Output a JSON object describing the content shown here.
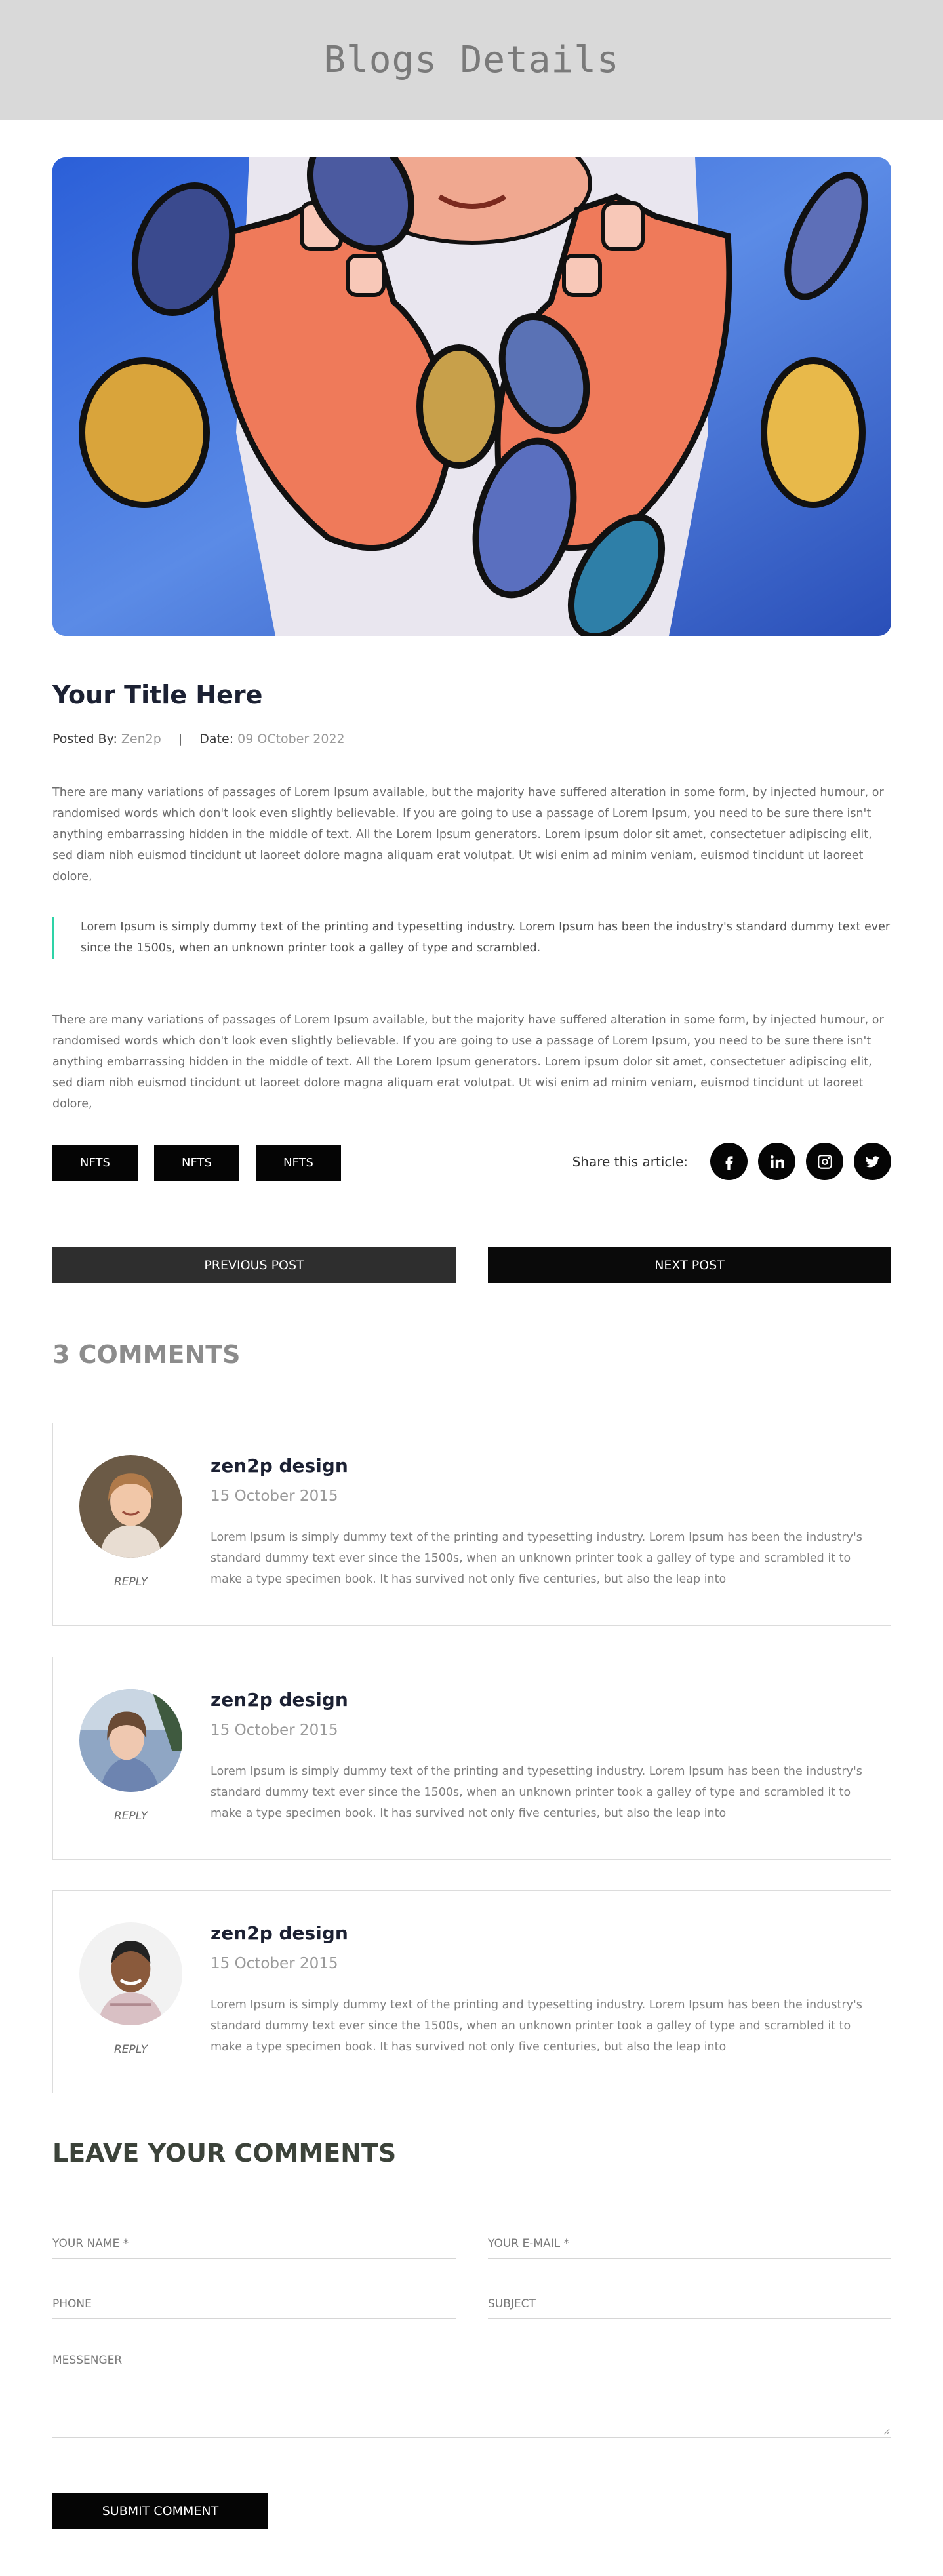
{
  "banner": {
    "title": "Blogs Details"
  },
  "hero": {
    "image": "illustration-hands-holding-nft-coins"
  },
  "post": {
    "title": "Your Title Here",
    "posted_by_label": "Posted By:",
    "author": "Zen2p",
    "separator": "|",
    "date_label": "Date:",
    "date": "09 OCtober 2022",
    "paragraph_1": "There are many variations of passages of Lorem Ipsum available, but the majority have suffered alteration in some form, by injected humour, or randomised words which don't look even slightly believable. If you are going to use a passage of Lorem Ipsum, you need to be sure there isn't anything embarrassing hidden in the middle of text. All the Lorem Ipsum generators. Lorem ipsum dolor sit amet, consectetuer adipiscing elit, sed diam nibh euismod tincidunt ut laoreet dolore magna aliquam erat volutpat. Ut wisi enim ad minim veniam, euismod tincidunt ut laoreet dolore,",
    "quote": "Lorem Ipsum is simply dummy text of the printing and typesetting industry. Lorem Ipsum has been the industry's standard dummy text ever since the 1500s, when an unknown printer took a galley of type and scrambled.",
    "paragraph_2": "There are many variations of passages of Lorem Ipsum available, but the majority have suffered alteration in some form, by injected humour, or randomised words which don't look even slightly believable. If you are going to use a passage of Lorem Ipsum, you need to be sure there isn't anything embarrassing hidden in the middle of text. All the Lorem Ipsum generators. Lorem ipsum dolor sit amet, consectetuer adipiscing elit, sed diam nibh euismod tincidunt ut laoreet dolore magna aliquam erat volutpat. Ut wisi enim ad minim veniam, euismod tincidunt ut laoreet dolore,"
  },
  "tags": [
    "NFTS",
    "NFTS",
    "NFTS"
  ],
  "share": {
    "label": "Share this article:",
    "icons": [
      "facebook-icon",
      "linkedin-icon",
      "instagram-icon",
      "twitter-icon"
    ]
  },
  "post_nav": {
    "previous": "PREVIOUS POST",
    "next": "NEXT POST"
  },
  "comments": {
    "heading": "3 COMMENTS",
    "items": [
      {
        "name": "zen2p design",
        "date": "15 October 2015",
        "reply": "REPLY",
        "avatar": "woman-smiling-avatar",
        "text": "Lorem Ipsum is simply dummy text of the printing and typesetting industry. Lorem Ipsum has been the industry's standard dummy text ever since the 1500s, when an unknown printer took a galley of type and scrambled it to make a type specimen book. It has survived not only five centuries, but also the leap into"
      },
      {
        "name": "zen2p design",
        "date": "15 October 2015",
        "reply": "REPLY",
        "avatar": "woman-outdoors-avatar",
        "text": "Lorem Ipsum is simply dummy text of the printing and typesetting industry. Lorem Ipsum has been the industry's standard dummy text ever since the 1500s, when an unknown printer took a galley of type and scrambled it to make a type specimen book. It has survived not only five centuries, but also the leap into"
      },
      {
        "name": "zen2p design",
        "date": "15 October 2015",
        "reply": "REPLY",
        "avatar": "man-smiling-avatar",
        "text": "Lorem Ipsum is simply dummy text of the printing and typesetting industry. Lorem Ipsum has been the industry's standard dummy text ever since the 1500s, when an unknown printer took a galley of type and scrambled it to make a type specimen book. It has survived not only five centuries, but also the leap into"
      }
    ]
  },
  "form": {
    "heading": "LEAVE YOUR COMMENTS",
    "name_placeholder": "YOUR NAME *",
    "email_placeholder": "YOUR E-MAIL *",
    "phone_placeholder": "PHONE",
    "subject_placeholder": "SUBJECT",
    "message_placeholder": "MESSENGER",
    "submit_label": "SUBMIT COMMENT"
  },
  "colors": {
    "banner_bg": "#d9d9d9",
    "dark": "#050505",
    "quote_accent": "#2ed3a7",
    "title": "#1c2133"
  }
}
